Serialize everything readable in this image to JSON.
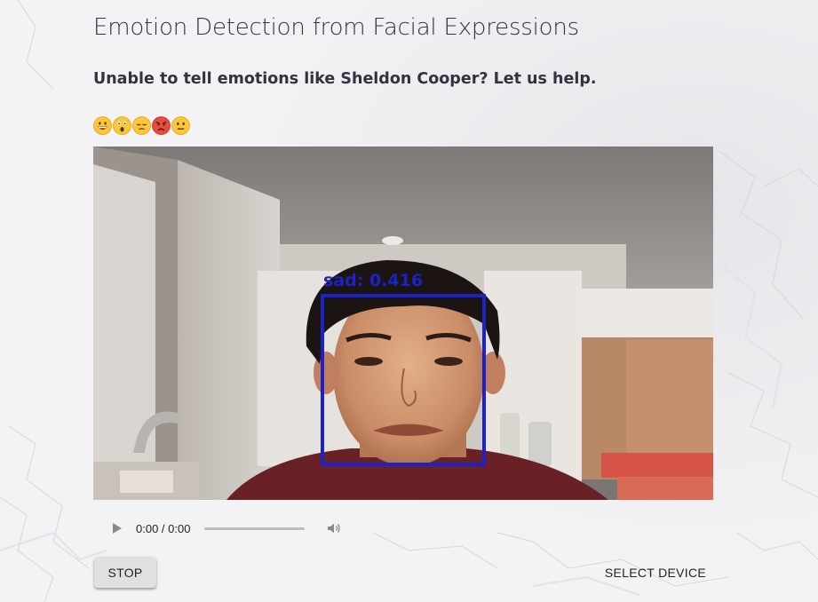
{
  "header": {
    "title": "Emotion Detection from Facial Expressions",
    "subtitle": "Unable to tell emotions like Sheldon Cooper? Let us help."
  },
  "emojis": [
    "grinning-face",
    "astonished-face",
    "pensive-face",
    "pouting-face",
    "neutral-face"
  ],
  "video": {
    "detection_label": "sad: 0.416",
    "overlay_color": "#1a22c8"
  },
  "audio": {
    "time": "0:00 / 0:00"
  },
  "controls": {
    "stop_label": "STOP",
    "select_device_label": "SELECT DEVICE"
  }
}
